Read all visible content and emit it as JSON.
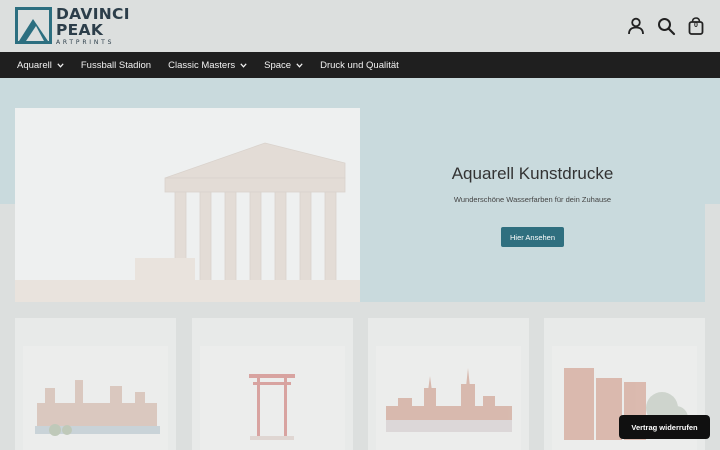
{
  "brand": {
    "line1": "DAVINCI",
    "line2": "PEAK",
    "line3": "ARTPRINTS",
    "color": "#2c3e4a"
  },
  "header": {
    "icons": [
      "account-icon",
      "search-icon",
      "cart-icon"
    ],
    "cart_count": "0"
  },
  "nav": {
    "items": [
      {
        "label": "Aquarell",
        "has_dropdown": true
      },
      {
        "label": "Fussball Stadion",
        "has_dropdown": false
      },
      {
        "label": "Classic Masters",
        "has_dropdown": true
      },
      {
        "label": "Space",
        "has_dropdown": true
      },
      {
        "label": "Druck und Qualität",
        "has_dropdown": false
      }
    ],
    "background": "#1f1f1f"
  },
  "hero": {
    "title": "Aquarell Kunstdrucke",
    "subtitle": "Wunderschöne Wasserfarben für dein Zuhause",
    "button_label": "Hier Ansehen",
    "button_color": "#2f6f7f",
    "background": "#c9dadd"
  },
  "products": [
    {
      "image": "watercolor-city-harbor"
    },
    {
      "image": "watercolor-torii-gate"
    },
    {
      "image": "watercolor-city-skyline"
    },
    {
      "image": "watercolor-street-houses"
    }
  ],
  "floating_button": {
    "label": "Vertrag widerrufen"
  }
}
